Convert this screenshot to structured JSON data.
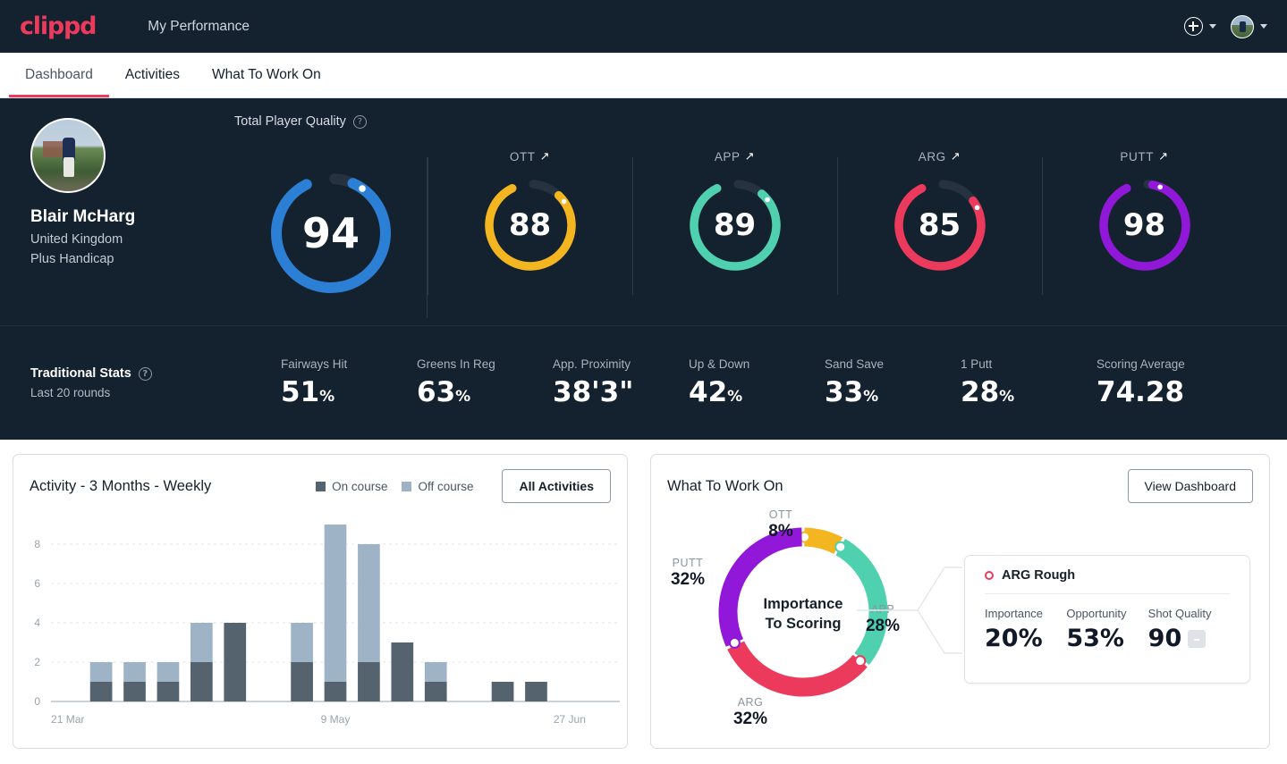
{
  "header": {
    "logo": "clippd",
    "app_title": "My Performance",
    "add_icon": "plus-circle-icon",
    "avatar_icon": "user-avatar"
  },
  "tabs": [
    {
      "label": "Dashboard",
      "active": true
    },
    {
      "label": "Activities",
      "active": false
    },
    {
      "label": "What To Work On",
      "active": false
    }
  ],
  "profile": {
    "name": "Blair McHarg",
    "country": "United Kingdom",
    "handicap": "Plus Handicap"
  },
  "quality": {
    "section_label": "Total Player Quality",
    "help_icon": "question-mark-icon",
    "main": {
      "label": "",
      "value": "94",
      "color": "#2b7fd4",
      "pct": 94
    },
    "sub": [
      {
        "label": "OTT",
        "value": "88",
        "color": "#f3b620",
        "pct": 88,
        "trend": "↗"
      },
      {
        "label": "APP",
        "value": "89",
        "color": "#4fd1b0",
        "pct": 89,
        "trend": "↗"
      },
      {
        "label": "ARG",
        "value": "85",
        "color": "#ec3a5c",
        "pct": 85,
        "trend": "↗"
      },
      {
        "label": "PUTT",
        "value": "98",
        "color": "#9118d8",
        "pct": 98,
        "trend": "↗"
      }
    ]
  },
  "traditional_stats": {
    "title": "Traditional Stats",
    "help_icon": "question-mark-icon",
    "subtitle": "Last 20 rounds",
    "items": [
      {
        "label": "Fairways Hit",
        "value": "51",
        "unit": "%"
      },
      {
        "label": "Greens In Reg",
        "value": "63",
        "unit": "%"
      },
      {
        "label": "App. Proximity",
        "value": "38'3\"",
        "unit": ""
      },
      {
        "label": "Up & Down",
        "value": "42",
        "unit": "%"
      },
      {
        "label": "Sand Save",
        "value": "33",
        "unit": "%"
      },
      {
        "label": "1 Putt",
        "value": "28",
        "unit": "%"
      },
      {
        "label": "Scoring Average",
        "value": "74.28",
        "unit": ""
      }
    ]
  },
  "activity_card": {
    "title": "Activity - 3 Months - Weekly",
    "legend": [
      {
        "label": "On course",
        "color": "#55636f"
      },
      {
        "label": "Off course",
        "color": "#9fb3c6"
      }
    ],
    "button": "All Activities"
  },
  "chart_data": {
    "type": "bar",
    "title": "Activity - 3 Months - Weekly",
    "stacked": true,
    "xlabel": "",
    "ylabel": "",
    "ylim": [
      0,
      9
    ],
    "yticks": [
      0,
      2,
      4,
      6,
      8
    ],
    "grid": true,
    "legend_position": "top-right",
    "categories": [
      "21 Mar",
      "",
      "",
      "",
      "",
      "",
      "",
      "",
      "9 May",
      "",
      "",
      "",
      "",
      "",
      "",
      "27 Jun",
      ""
    ],
    "tick_labels": [
      {
        "index": 0,
        "label": "21 Mar"
      },
      {
        "index": 8,
        "label": "9 May"
      },
      {
        "index": 15,
        "label": "27 Jun"
      }
    ],
    "series": [
      {
        "name": "On course",
        "color": "#55636f",
        "values": [
          0,
          1,
          1,
          1,
          2,
          4,
          0,
          2,
          1,
          2,
          3,
          1,
          0,
          1,
          1,
          0,
          0
        ]
      },
      {
        "name": "Off course",
        "color": "#9fb3c6",
        "values": [
          0,
          1,
          1,
          1,
          2,
          0,
          0,
          2,
          8,
          6,
          0,
          1,
          0,
          0,
          0,
          0,
          0
        ]
      }
    ]
  },
  "wtwo_card": {
    "title": "What To Work On",
    "button": "View Dashboard",
    "center_line1": "Importance",
    "center_line2": "To Scoring",
    "donut": {
      "type": "pie",
      "title": "Importance To Scoring",
      "segments": [
        {
          "name": "OTT",
          "value": 8,
          "label": "8%",
          "color": "#f3b620"
        },
        {
          "name": "APP",
          "value": 28,
          "label": "28%",
          "color": "#4fd1b0"
        },
        {
          "name": "ARG",
          "value": 32,
          "label": "32%",
          "color": "#ec3a5c"
        },
        {
          "name": "PUTT",
          "value": 32,
          "label": "32%",
          "color": "#9118d8"
        }
      ]
    },
    "detail": {
      "title": "ARG Rough",
      "marker_color": "#ec3a5c",
      "metrics": [
        {
          "label": "Importance",
          "value": "20%"
        },
        {
          "label": "Opportunity",
          "value": "53%"
        },
        {
          "label": "Shot Quality",
          "value": "90",
          "badge": "–"
        }
      ]
    }
  }
}
